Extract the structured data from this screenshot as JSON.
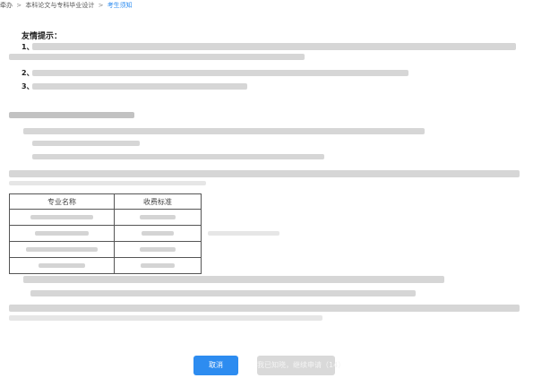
{
  "breadcrumb": {
    "items": [
      {
        "label": "牵办",
        "current": false
      },
      {
        "label": "本科论文与专科毕业设计",
        "current": false
      },
      {
        "label": "考生须知",
        "current": true
      }
    ],
    "separator": ">"
  },
  "notice": {
    "title": "友情提示：",
    "numbers": [
      "1、",
      "2、",
      "3、"
    ]
  },
  "fee_table": {
    "headers": [
      "专业名称",
      "收费标准"
    ],
    "rows": 4
  },
  "buttons": {
    "cancel_label": "取消",
    "confirm_label": "我已知晓，继续申请（14）"
  },
  "colors": {
    "primary": "#2d8cf0",
    "disabled": "#d9d9d9",
    "blurred_text": "#d6d6d6"
  }
}
